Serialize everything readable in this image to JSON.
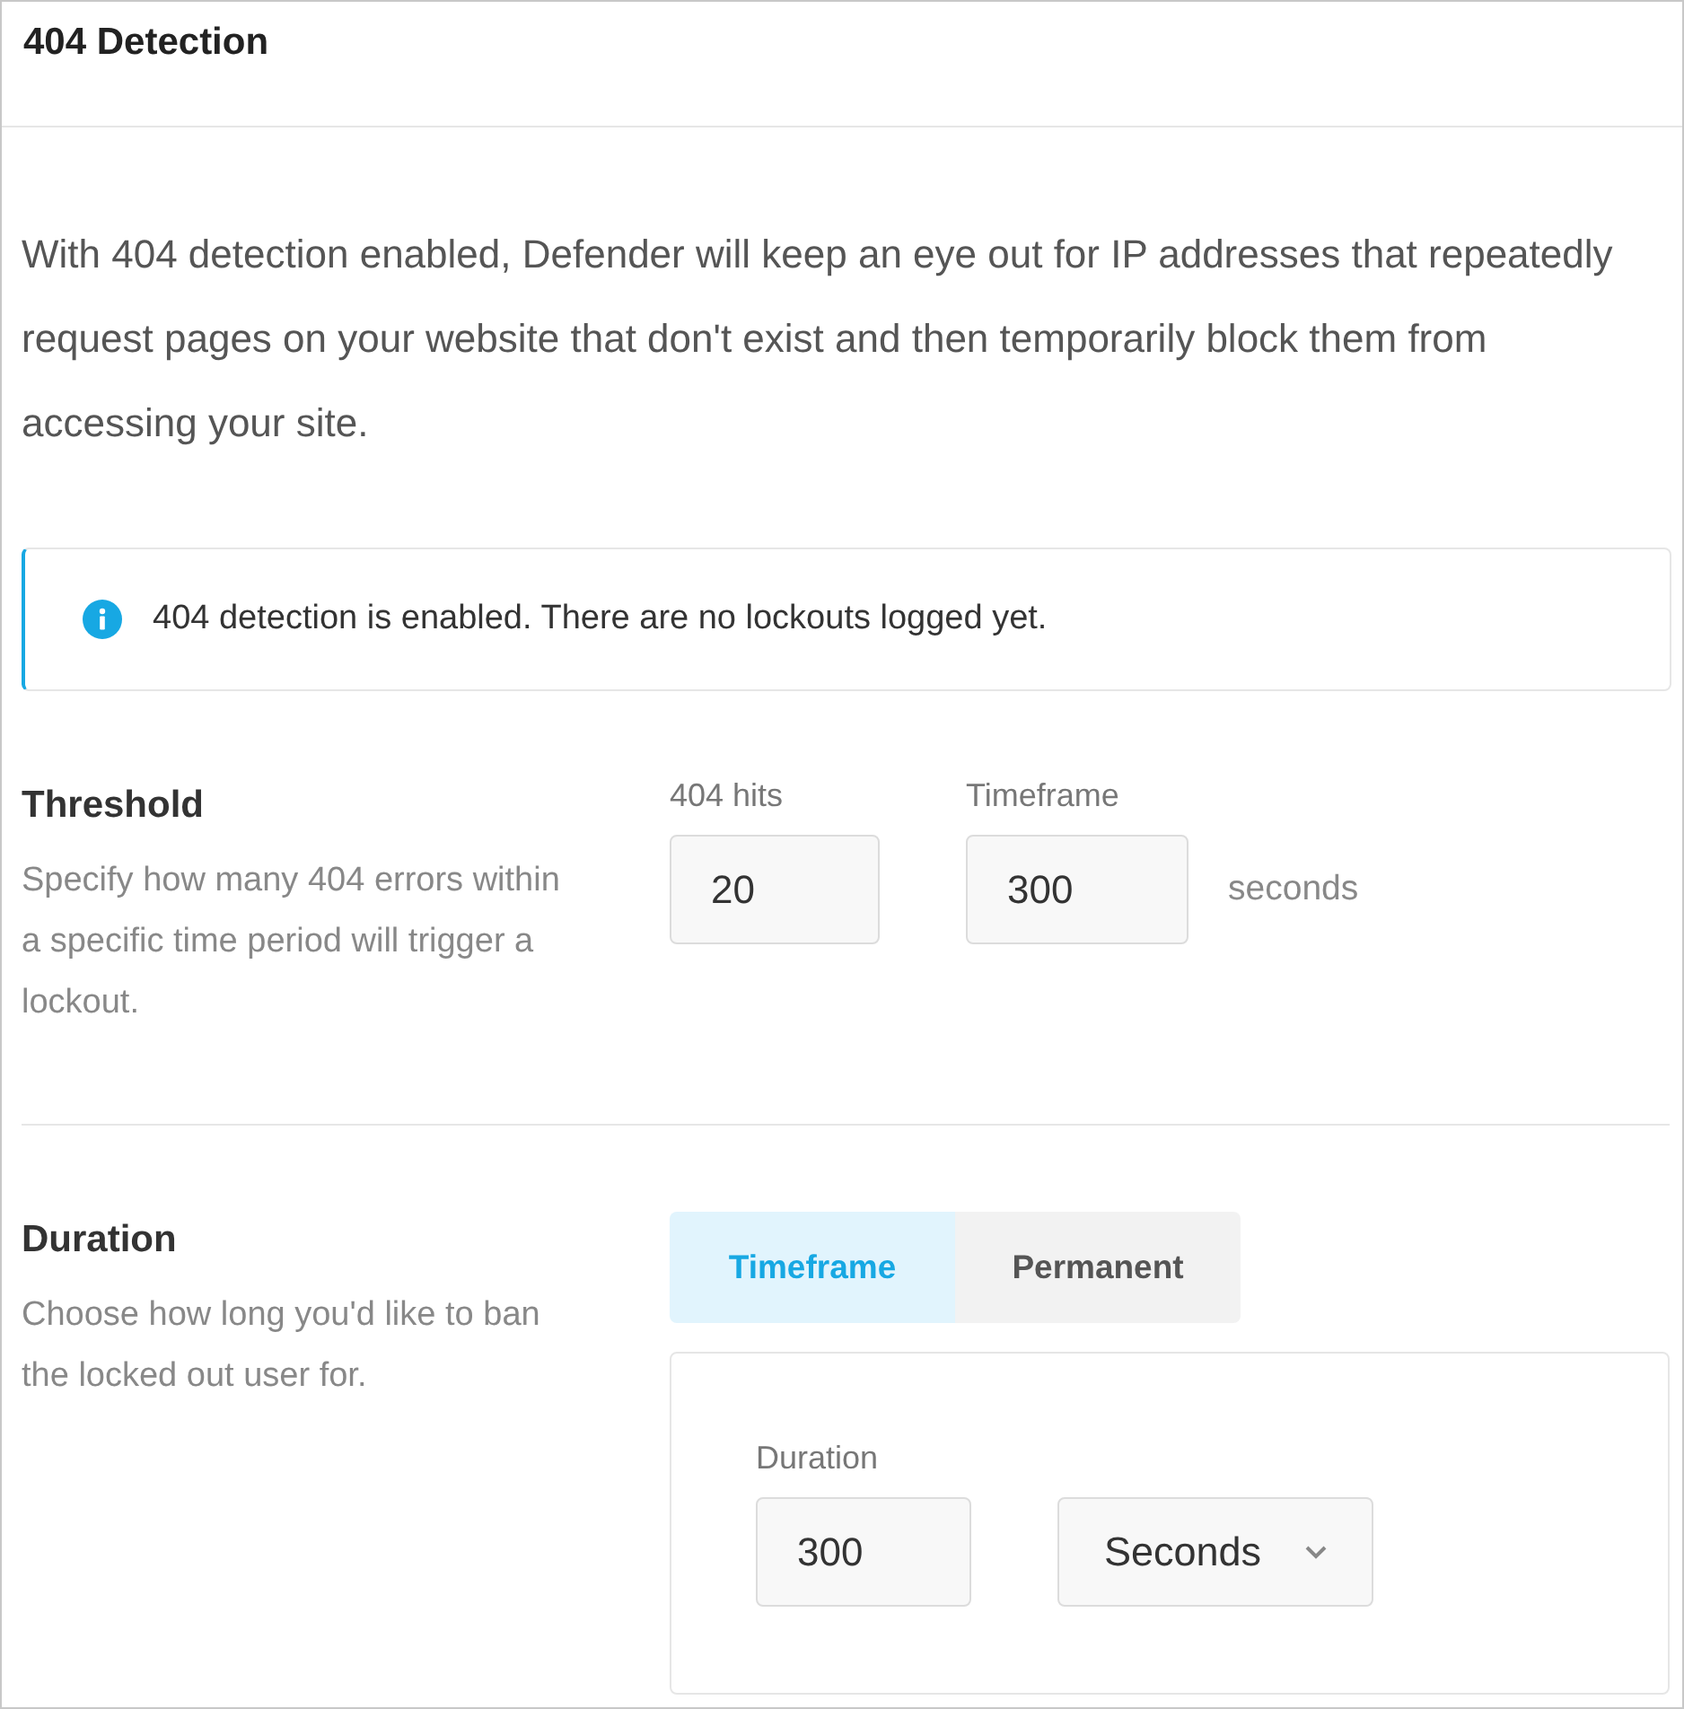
{
  "header": {
    "title": "404 Detection"
  },
  "intro": "With 404 detection enabled, Defender will keep an eye out for IP addresses that repeatedly request pages on your website that don't exist and then temporarily block them from accessing your site.",
  "notice": {
    "text": "404 detection is enabled. There are no lockouts logged yet."
  },
  "threshold": {
    "title": "Threshold",
    "description": "Specify how many 404 errors within a specific time period will trigger a lockout.",
    "fields": [
      {
        "label": "404 hits",
        "value": "20"
      },
      {
        "label": "Timeframe",
        "value": "300",
        "suffix": "seconds"
      }
    ]
  },
  "duration": {
    "title": "Duration",
    "description": "Choose how long you'd like to ban the locked out user for.",
    "tabs": [
      {
        "label": "Timeframe",
        "selected": true
      },
      {
        "label": "Permanent",
        "selected": false
      }
    ],
    "field_label": "Duration",
    "value": "300",
    "unit": "Seconds"
  }
}
